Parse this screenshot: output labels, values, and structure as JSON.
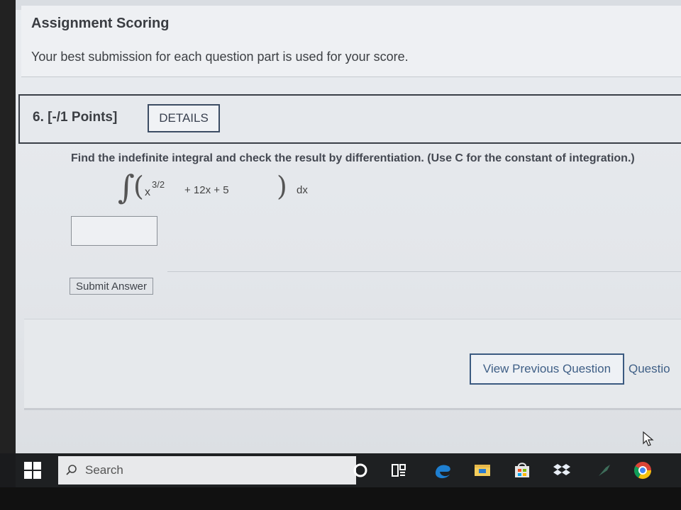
{
  "scoring": {
    "title": "Assignment Scoring",
    "text": "Your best submission for each question part is used for your score."
  },
  "question": {
    "number_label": "6.  [-/1 Points]",
    "details_label": "DETAILS",
    "prompt": "Find the indefinite integral and check the result by differentiation. (Use C for the constant of integration.)",
    "formula": {
      "base": "x",
      "exponent": "3/2",
      "terms": "+  12x  +  5",
      "differential": "dx"
    },
    "answer_value": "",
    "submit_label": "Submit Answer"
  },
  "navigation": {
    "prev_label": "View Previous Question",
    "next_label": "Questio"
  },
  "taskbar": {
    "search_placeholder": "Search",
    "icons": [
      "windows-icon",
      "search-icon",
      "cortana-icon",
      "task-view-icon",
      "edge-icon",
      "file-explorer-icon",
      "store-icon",
      "dropbox-icon",
      "app-icon",
      "chrome-icon"
    ]
  },
  "colors": {
    "accent": "#3b5a80",
    "taskbar": "#1e2022",
    "text": "#3d4044"
  }
}
